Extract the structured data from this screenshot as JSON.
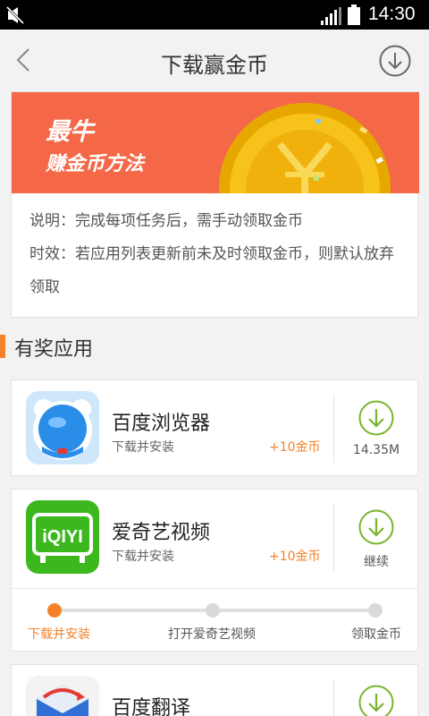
{
  "status_bar": {
    "time": "14:30",
    "icons": [
      "mute-icon",
      "signal-icon",
      "battery-icon"
    ]
  },
  "header": {
    "title": "下载赢金币",
    "back_icon": "chevron-left-icon",
    "download_icon": "download-circle-icon"
  },
  "banner": {
    "line1": "最牛",
    "line2": "赚金币方法"
  },
  "description": {
    "line1": "说明：完成每项任务后，需手动领取金币",
    "line2": "时效：若应用列表更新前未及时领取金币，则默认放弃领取"
  },
  "section": {
    "title": "有奖应用"
  },
  "apps": [
    {
      "name": "百度浏览器",
      "task": "下载并安装",
      "reward": "+10金币",
      "button_text": "14.35M"
    },
    {
      "name": "爱奇艺视频",
      "task": "下载并安装",
      "reward": "+10金币",
      "button_text": "继续",
      "steps": [
        "下载并安装",
        "打开爱奇艺视频",
        "领取金币"
      ],
      "current_step": 1
    },
    {
      "name": "百度翻译"
    }
  ],
  "colors": {
    "accent": "#f5822a",
    "banner": "#f46848",
    "download_green": "#7ab32e"
  }
}
